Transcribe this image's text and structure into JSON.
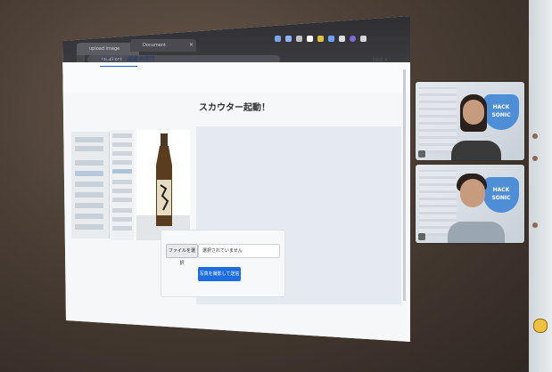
{
  "browser": {
    "tabs": [
      {
        "label": "upload image"
      },
      {
        "label": "Document"
      }
    ],
    "url": "localhost"
  },
  "app": {
    "nav": [
      "スカウター画面",
      "絵名画面医"
    ],
    "user_menu": "test ▾",
    "section_title": "スカウター起動！",
    "file_button": "ファイルを選択",
    "file_status": "選択されていません",
    "submit_button": "写真を撮影して送信"
  },
  "video_call": {
    "tiles": [
      {
        "banner": "HACK SONIC"
      },
      {
        "banner": "HACK SONIC"
      }
    ]
  }
}
